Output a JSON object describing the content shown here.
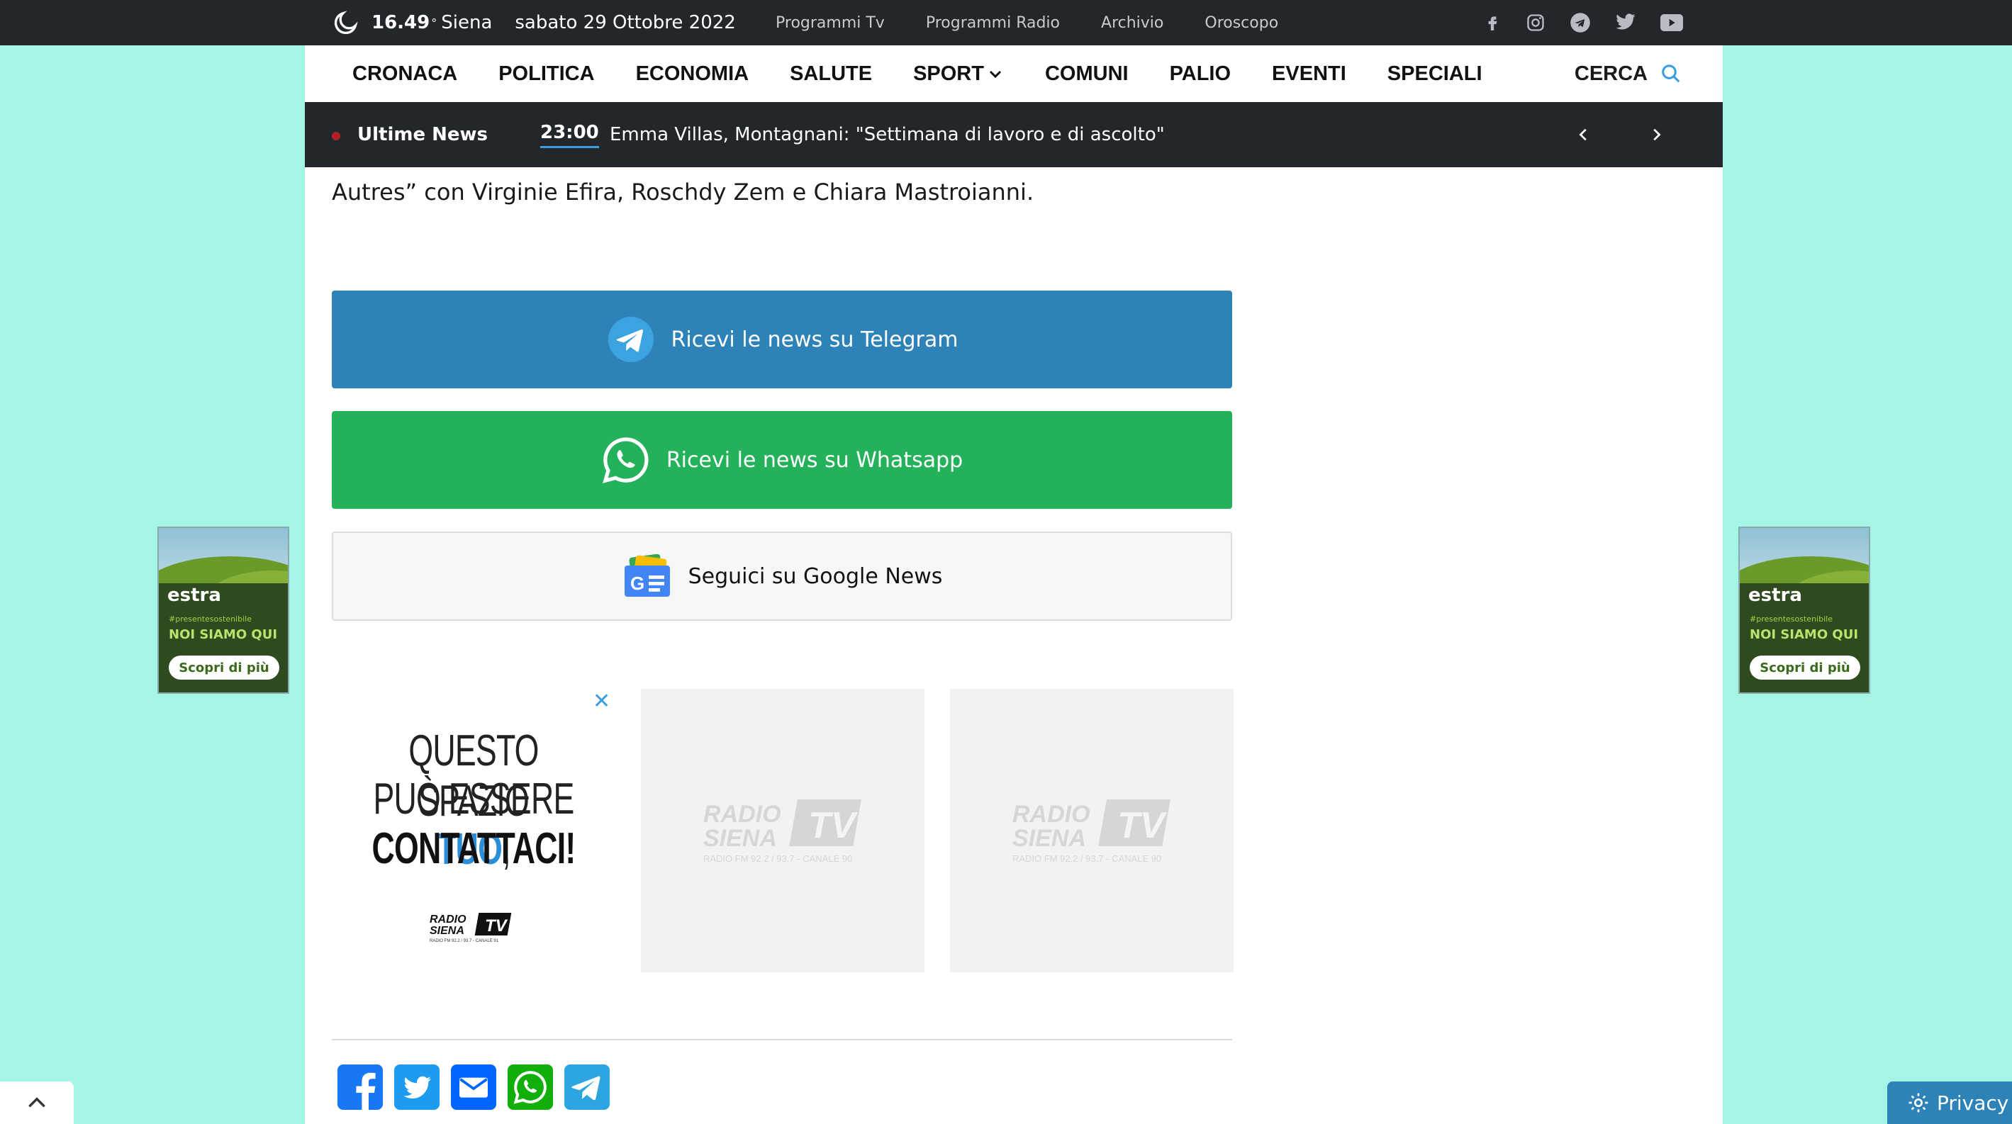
{
  "topbar": {
    "temperature": "16.49",
    "degree_symbol": "°",
    "city": "Siena",
    "date": "sabato 29 Ottobre 2022",
    "links": [
      "Programmi Tv",
      "Programmi Radio",
      "Archivio",
      "Oroscopo"
    ],
    "social_icons": [
      "facebook-icon",
      "instagram-icon",
      "telegram-icon",
      "twitter-icon",
      "youtube-icon"
    ]
  },
  "nav": {
    "items": [
      "CRONACA",
      "POLITICA",
      "ECONOMIA",
      "SALUTE",
      "SPORT",
      "COMUNI",
      "PALIO",
      "EVENTI",
      "SPECIALI"
    ],
    "search_label": "CERCA"
  },
  "ticker": {
    "label": "Ultime News",
    "time": "23:00",
    "headline": "Emma Villas, Montagnani: \"Settimana di lavoro e di ascolto\""
  },
  "article": {
    "paragraph_tail": "Autres” con Virginie Efira, Roschdy Zem e Chiara Mastroianni.",
    "telegram_cta": "Ricevi le news su Telegram",
    "whatsapp_cta": "Ricevi le news su Whatsapp",
    "google_news_cta": "Seguici su Google News"
  },
  "ads": {
    "close_symbol": "✕",
    "line1": "QUESTO SPAZIO",
    "line2_a": "PUÒ ESSERE ",
    "line2_b": "TUO",
    "line2_c": ",",
    "line3": "CONTATTACI!",
    "mini_logo_line1": "RADIO",
    "mini_logo_line2": "SIENA",
    "mini_logo_tv": "TV",
    "mini_logo_sub": "RADIO FM 92.2 / 93.7 - CANALE 91",
    "placeholder_line1": "RADIO",
    "placeholder_line2": "SIENA",
    "placeholder_tv": "TV",
    "placeholder_sub": "RADIO FM 92.2 / 93.7 - CANALE 90"
  },
  "side_banner": {
    "brand": "estra",
    "hashtag": "#presentesostenibile",
    "slogan": "NOI SIAMO QUI",
    "button": "Scopri di più"
  },
  "share_icons": [
    "facebook-icon",
    "twitter-icon",
    "email-icon",
    "whatsapp-icon",
    "telegram-icon"
  ],
  "privacy_label": "Privacy",
  "colors": {
    "background": "#a5f5e6",
    "dark_bar": "#23262b",
    "telegram": "#2d82b8",
    "whatsapp": "#23b15a",
    "accent": "#3b9ddd"
  }
}
